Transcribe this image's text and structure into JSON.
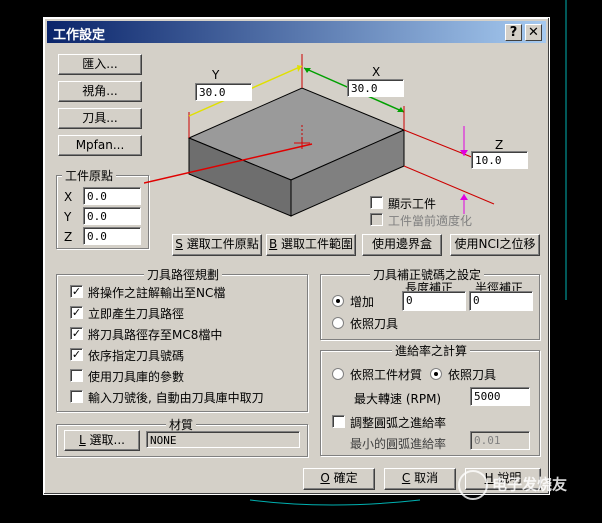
{
  "window": {
    "title": "工作設定",
    "help_glyph": "?",
    "close_glyph": "✕"
  },
  "left_buttons": [
    "匯入...",
    "視角...",
    "刀具...",
    "Mpfan..."
  ],
  "origin": {
    "title": "工件原點",
    "x_label": "X",
    "x_value": "0.0",
    "y_label": "Y",
    "y_value": "0.0",
    "z_label": "Z",
    "z_value": "0.0"
  },
  "preview": {
    "y_label": "Y",
    "y_value": "30.0",
    "x_label": "X",
    "x_value": "30.0",
    "z_label": "Z",
    "z_value": "10.0",
    "show_workpiece": "顯示工件",
    "fit_window": "工件當前適度化"
  },
  "action_buttons": [
    {
      "key": "S",
      "label": " 選取工件原點"
    },
    {
      "key": "B",
      "label": " 選取工件範圍"
    },
    {
      "key": "",
      "label": "使用邊界盒"
    },
    {
      "key": "",
      "label": "使用NCI之位移"
    }
  ],
  "toolpath": {
    "title": "刀具路徑規劃",
    "options": [
      {
        "label": "將操作之註解輸出至NC檔",
        "checked": true
      },
      {
        "label": "立即產生刀具路徑",
        "checked": true
      },
      {
        "label": "將刀具路徑存至MC8檔中",
        "checked": true
      },
      {
        "label": "依序指定刀具號碼",
        "checked": true
      },
      {
        "label": "使用刀具庫的參數",
        "checked": false
      },
      {
        "label": "輸入刀號後, 自動由刀具庫中取刀",
        "checked": false
      }
    ]
  },
  "material": {
    "title": "材質",
    "select_key": "L",
    "select_label": " 選取...",
    "value": "NONE"
  },
  "compensation": {
    "title": "刀具補正號碼之設定",
    "length_label": "長度補正",
    "radius_label": "半徑補正",
    "add_label": "增加",
    "follow_label": "依照刀具",
    "length_value": "0",
    "radius_value": "0"
  },
  "feed": {
    "title": "進給率之計算",
    "material_option": "依照工件材質",
    "tool_option": "依照刀具",
    "max_rpm_label": "最大轉速 (RPM)",
    "max_rpm_value": "5000",
    "arc_label": "調整圓弧之進給率",
    "min_arc_label": "最小的圓弧進給率",
    "min_arc_value": "0.01"
  },
  "footer": {
    "ok_key": "O",
    "ok_label": " 確定",
    "cancel_key": "C",
    "cancel_label": " 取消",
    "help_key": "H",
    "help_label": " 說明"
  },
  "watermark": "电子发烧友",
  "colors": {
    "title_start": "#0a246a",
    "title_end": "#a6caf0",
    "face": "#d4d0c8"
  }
}
